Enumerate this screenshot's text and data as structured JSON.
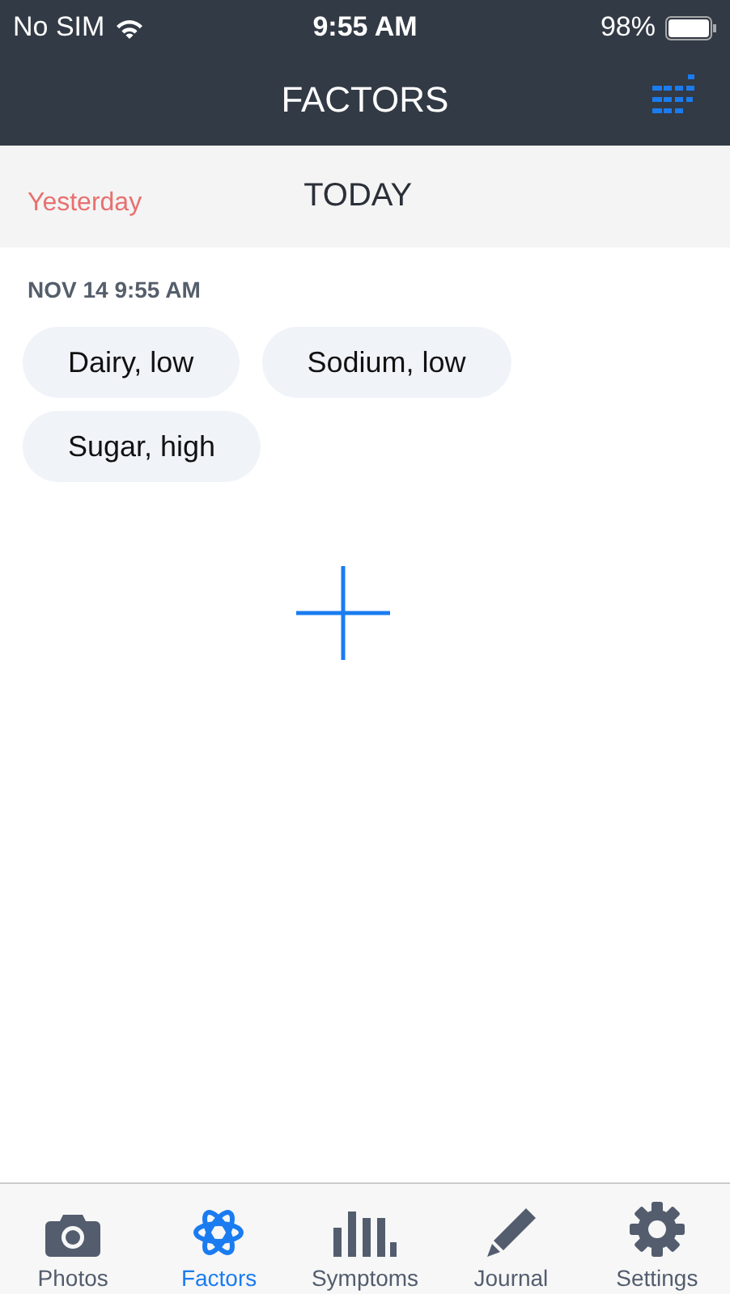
{
  "status_bar": {
    "carrier": "No SIM",
    "time": "9:55 AM",
    "battery": "98%"
  },
  "header": {
    "title": "FACTORS"
  },
  "day_tabs": [
    {
      "label": "Yesterday",
      "selected": false
    },
    {
      "label": "TODAY",
      "selected": true
    }
  ],
  "entry": {
    "timestamp": "NOV 14 9:55 AM",
    "factors": [
      "Dairy, low",
      "Sodium, low",
      "Sugar, high"
    ]
  },
  "tab_bar": [
    {
      "label": "Photos",
      "kind": "camera",
      "selected": false
    },
    {
      "label": "Factors",
      "kind": "atom",
      "selected": true
    },
    {
      "label": "Symptoms",
      "kind": "bars",
      "selected": false
    },
    {
      "label": "Journal",
      "kind": "pencil",
      "selected": false
    },
    {
      "label": "Settings",
      "kind": "gear",
      "selected": false
    }
  ]
}
